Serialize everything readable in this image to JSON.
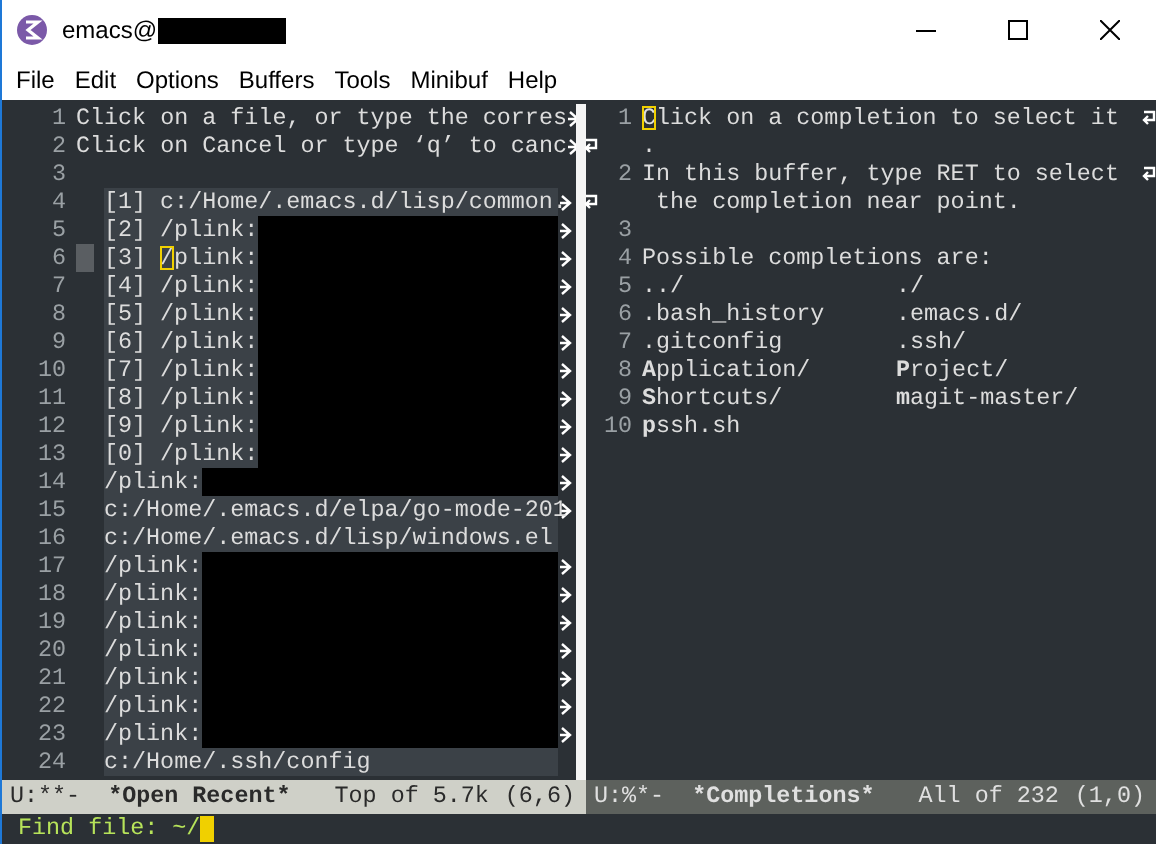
{
  "window": {
    "title": "emacs@",
    "title_redacted": true
  },
  "menu": [
    "File",
    "Edit",
    "Options",
    "Buffers",
    "Tools",
    "Minibuf",
    "Help"
  ],
  "left_pane": {
    "lines": [
      {
        "number": "1",
        "text": "Click on a file, or type the corres",
        "truncated": true,
        "highlighted": false
      },
      {
        "number": "2",
        "text": "Click on Cancel or type ‘q’ to canc",
        "truncated": true,
        "highlighted": false
      },
      {
        "number": "3",
        "truncated": false,
        "highlighted": false
      },
      {
        "number": "4",
        "key": "[1]",
        "text": "c:/Home/.emacs.d/lisp/common.",
        "truncated": true,
        "highlighted": true
      },
      {
        "number": "5",
        "key": "[2]",
        "text": "/plink:",
        "redacted": true,
        "truncated": true,
        "highlighted": true
      },
      {
        "number": "6",
        "key": "[3]",
        "text": "/plink:",
        "redacted": true,
        "truncated": true,
        "highlighted": true,
        "current": true
      },
      {
        "number": "7",
        "key": "[4]",
        "text": "/plink:",
        "redacted": true,
        "truncated": true,
        "highlighted": true
      },
      {
        "number": "8",
        "key": "[5]",
        "text": "/plink:",
        "redacted": true,
        "truncated": true,
        "highlighted": true
      },
      {
        "number": "9",
        "key": "[6]",
        "text": "/plink:",
        "redacted": true,
        "truncated": true,
        "highlighted": true
      },
      {
        "number": "10",
        "key": "[7]",
        "text": "/plink:",
        "redacted": true,
        "truncated": true,
        "highlighted": true
      },
      {
        "number": "11",
        "key": "[8]",
        "text": "/plink:",
        "redacted": true,
        "truncated": true,
        "highlighted": true
      },
      {
        "number": "12",
        "key": "[9]",
        "text": "/plink:",
        "redacted": true,
        "truncated": true,
        "highlighted": true
      },
      {
        "number": "13",
        "key": "[0]",
        "text": "/plink:",
        "redacted": true,
        "truncated": true,
        "highlighted": true
      },
      {
        "number": "14",
        "text": "/plink:",
        "redacted": true,
        "truncated": true,
        "highlighted": true
      },
      {
        "number": "15",
        "text": "c:/Home/.emacs.d/elpa/go-mode-201",
        "truncated": true,
        "highlighted": true
      },
      {
        "number": "16",
        "text": "c:/Home/.emacs.d/lisp/windows.el",
        "truncated": false,
        "highlighted": true
      },
      {
        "number": "17",
        "text": "/plink:",
        "redacted": true,
        "truncated": true,
        "highlighted": true
      },
      {
        "number": "18",
        "text": "/plink:",
        "redacted": true,
        "truncated": true,
        "highlighted": true
      },
      {
        "number": "19",
        "text": "/plink:",
        "redacted": true,
        "truncated": true,
        "highlighted": true
      },
      {
        "number": "20",
        "text": "/plink:",
        "redacted": true,
        "truncated": true,
        "highlighted": true
      },
      {
        "number": "21",
        "text": "/plink:",
        "redacted": true,
        "truncated": true,
        "highlighted": true
      },
      {
        "number": "22",
        "text": "/plink:",
        "redacted": true,
        "truncated": true,
        "highlighted": true
      },
      {
        "number": "23",
        "text": "/plink:",
        "redacted": true,
        "truncated": true,
        "highlighted": true
      },
      {
        "number": "24",
        "text": "c:/Home/.ssh/config",
        "truncated": false,
        "highlighted": true
      }
    ],
    "mode_line": {
      "active": true,
      "flags": "U:**-",
      "buffer": "*Open Recent*",
      "position": "Top of 5.7k",
      "cursor": "(6,6)"
    }
  },
  "right_pane": {
    "lines": [
      {
        "number": "1",
        "text": "Click on a completion to select it",
        "cursor": true,
        "wrapped": [
          "."
        ]
      },
      {
        "number": "2",
        "text": "In this buffer, type RET to select",
        "wrapped": [
          " the completion near point."
        ]
      },
      {
        "number": "3"
      },
      {
        "number": "4",
        "text": "Possible completions are:"
      },
      {
        "number": "5",
        "columns": [
          "../",
          "./"
        ]
      },
      {
        "number": "6",
        "columns": [
          ".bash_history",
          ".emacs.d/"
        ]
      },
      {
        "number": "7",
        "columns": [
          ".gitconfig",
          ".ssh/"
        ]
      },
      {
        "number": "8",
        "columns": [
          "**A**pplication/",
          "**P**roject/"
        ]
      },
      {
        "number": "9",
        "columns": [
          "**S**hortcuts/",
          "**m**agit-master/"
        ]
      },
      {
        "number": "10",
        "columns": [
          "**p**ssh.sh"
        ]
      }
    ],
    "mode_line": {
      "active": false,
      "flags": "U:%*-",
      "buffer": "*Completions*",
      "position": "All of 232",
      "cursor": "(1,0)"
    }
  },
  "minibuffer": {
    "prompt": "Find file: ",
    "value": "~/"
  }
}
